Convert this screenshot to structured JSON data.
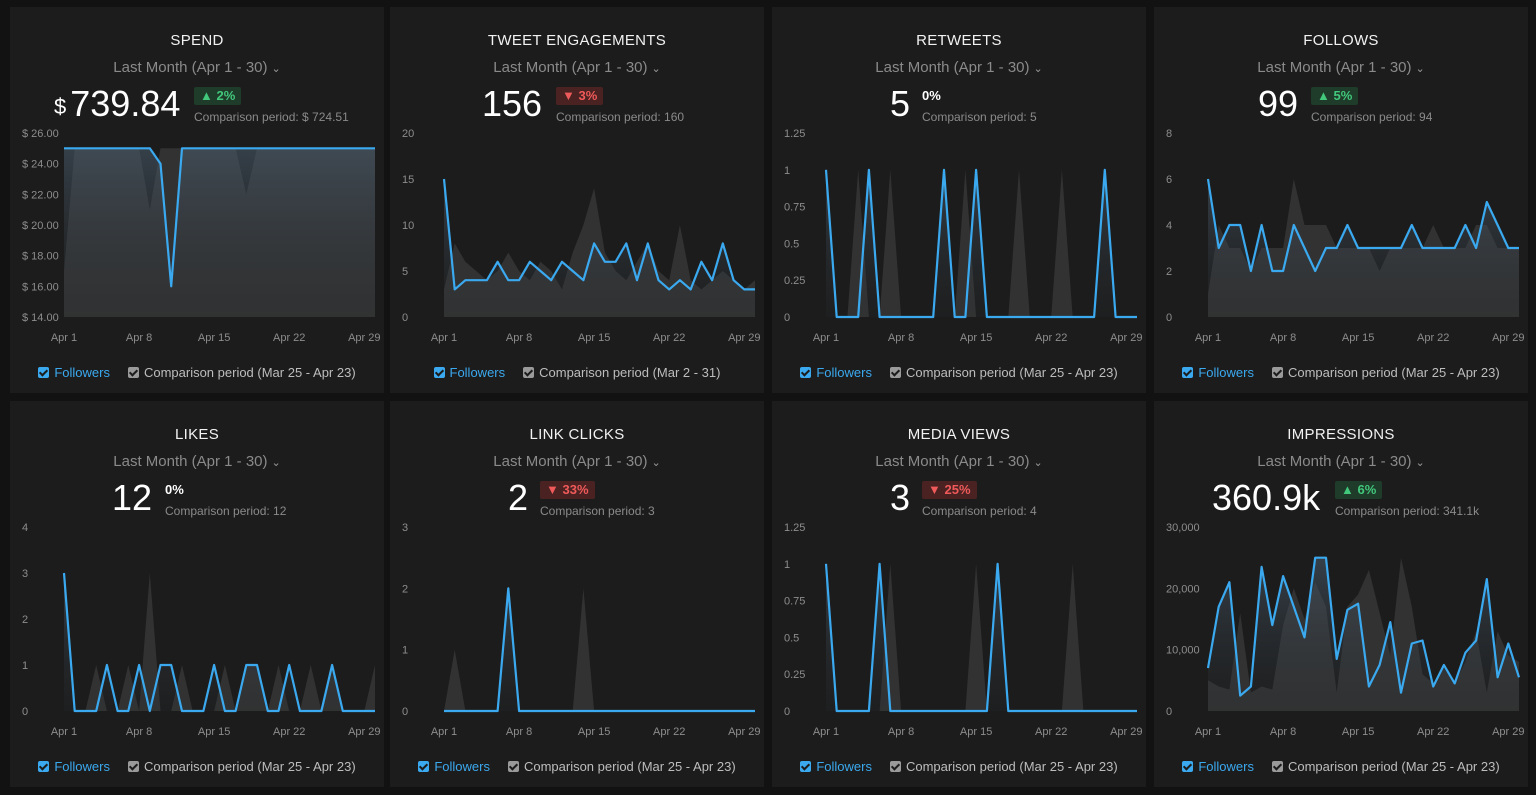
{
  "widgets": [
    {
      "title": "SPEND",
      "period": "Last Month (Apr 1 - 30)",
      "currency": "$",
      "value": "739.84",
      "change": {
        "direction": "up",
        "label": "▲ 2%"
      },
      "comparison_label": "Comparison period: $ 724.51",
      "legend": {
        "current": "Followers",
        "comparison": "Comparison period (Mar 25 - Apr 23)"
      },
      "colors": {
        "current": "#3ba9ef",
        "comparison": "#5a5a5a"
      },
      "chart_data": {
        "type": "area",
        "ylim": [
          14,
          26
        ],
        "yticks": [
          14,
          16,
          18,
          20,
          22,
          24,
          26
        ],
        "ytick_labels": [
          "$ 14.00",
          "$ 16.00",
          "$ 18.00",
          "$ 20.00",
          "$ 22.00",
          "$ 24.00",
          "$ 26.00"
        ],
        "xtick_labels": [
          "Apr 1",
          "Apr 8",
          "Apr 15",
          "Apr 22",
          "Apr 29"
        ],
        "xtick_index": [
          0,
          7,
          14,
          21,
          28
        ],
        "series": [
          {
            "name": "Followers",
            "values": [
              25,
              25,
              25,
              25,
              25,
              25,
              25,
              25,
              25,
              24,
              16,
              25,
              25,
              25,
              25,
              25,
              25,
              25,
              25,
              25,
              25,
              25,
              25,
              25,
              25,
              25,
              25,
              25,
              25,
              25
            ]
          },
          {
            "name": "Comparison period (Mar 25 - Apr 23)",
            "values": [
              17,
              25,
              25,
              25,
              25,
              25,
              25,
              25,
              21,
              25,
              25,
              25,
              25,
              25,
              25,
              25,
              25,
              22,
              25,
              25,
              25,
              25,
              25,
              25,
              25,
              25,
              25,
              25,
              25,
              25
            ]
          }
        ]
      }
    },
    {
      "title": "TWEET ENGAGEMENTS",
      "period": "Last Month (Apr 1 - 30)",
      "value": "156",
      "change": {
        "direction": "down",
        "label": "▼ 3%"
      },
      "comparison_label": "Comparison period: 160",
      "legend": {
        "current": "Followers",
        "comparison": "Comparison period (Mar 2 - 31)"
      },
      "colors": {
        "current": "#3ba9ef",
        "comparison": "#5a5a5a"
      },
      "chart_data": {
        "type": "area",
        "ylim": [
          0,
          20
        ],
        "yticks": [
          0,
          5,
          10,
          15,
          20
        ],
        "ytick_labels": [
          "0",
          "5",
          "10",
          "15",
          "20"
        ],
        "xtick_labels": [
          "Apr 1",
          "Apr 8",
          "Apr 15",
          "Apr 22",
          "Apr 29"
        ],
        "xtick_index": [
          0,
          7,
          14,
          21,
          28
        ],
        "series": [
          {
            "name": "Followers",
            "values": [
              15,
              3,
              4,
              4,
              4,
              6,
              4,
              4,
              6,
              5,
              4,
              6,
              5,
              4,
              8,
              6,
              6,
              8,
              4,
              8,
              4,
              3,
              4,
              3,
              6,
              4,
              8,
              4,
              3,
              3
            ]
          },
          {
            "name": "Comparison period (Mar 2 - 31)",
            "values": [
              3,
              8,
              6,
              5,
              4,
              5,
              7,
              5,
              4,
              6,
              5,
              3,
              7,
              10,
              14,
              7,
              5,
              4,
              6,
              8,
              5,
              4,
              10,
              4,
              3,
              4,
              5,
              4,
              3,
              4
            ]
          }
        ]
      }
    },
    {
      "title": "RETWEETS",
      "period": "Last Month (Apr 1 - 30)",
      "value": "5",
      "change": {
        "direction": "flat",
        "label": "0%"
      },
      "comparison_label": "Comparison period: 5",
      "legend": {
        "current": "Followers",
        "comparison": "Comparison period (Mar 25 - Apr 23)"
      },
      "colors": {
        "current": "#3ba9ef",
        "comparison": "#5a5a5a"
      },
      "chart_data": {
        "type": "area",
        "ylim": [
          0,
          1.25
        ],
        "yticks": [
          0,
          0.25,
          0.5,
          0.75,
          1,
          1.25
        ],
        "ytick_labels": [
          "0",
          "0.25",
          "0.5",
          "0.75",
          "1",
          "1.25"
        ],
        "xtick_labels": [
          "Apr 1",
          "Apr 8",
          "Apr 15",
          "Apr 22",
          "Apr 29"
        ],
        "xtick_index": [
          0,
          7,
          14,
          21,
          28
        ],
        "series": [
          {
            "name": "Followers",
            "values": [
              1,
              0,
              0,
              0,
              1,
              0,
              0,
              0,
              0,
              0,
              0,
              1,
              0,
              0,
              1,
              0,
              0,
              0,
              0,
              0,
              0,
              0,
              0,
              0,
              0,
              0,
              1,
              0,
              0,
              0
            ]
          },
          {
            "name": "Comparison period (Mar 25 - Apr 23)",
            "values": [
              0,
              0,
              0,
              1,
              0,
              0,
              1,
              0,
              0,
              0,
              0,
              0,
              0,
              1,
              0,
              0,
              0,
              0,
              1,
              0,
              0,
              0,
              1,
              0,
              0,
              0,
              0,
              0,
              0,
              0
            ]
          }
        ]
      }
    },
    {
      "title": "FOLLOWS",
      "period": "Last Month (Apr 1 - 30)",
      "value": "99",
      "change": {
        "direction": "up",
        "label": "▲ 5%"
      },
      "comparison_label": "Comparison period: 94",
      "legend": {
        "current": "Followers",
        "comparison": "Comparison period (Mar 25 - Apr 23)"
      },
      "colors": {
        "current": "#3ba9ef",
        "comparison": "#5a5a5a"
      },
      "chart_data": {
        "type": "area",
        "ylim": [
          0,
          8
        ],
        "yticks": [
          0,
          2,
          4,
          6,
          8
        ],
        "ytick_labels": [
          "0",
          "2",
          "4",
          "6",
          "8"
        ],
        "xtick_labels": [
          "Apr 1",
          "Apr 8",
          "Apr 15",
          "Apr 22",
          "Apr 29"
        ],
        "xtick_index": [
          0,
          7,
          14,
          21,
          28
        ],
        "series": [
          {
            "name": "Followers",
            "values": [
              6,
              3,
              4,
              4,
              2,
              4,
              2,
              2,
              4,
              3,
              2,
              3,
              3,
              4,
              3,
              3,
              3,
              3,
              3,
              4,
              3,
              3,
              3,
              3,
              4,
              3,
              5,
              4,
              3,
              3
            ]
          },
          {
            "name": "Comparison period (Mar 25 - Apr 23)",
            "values": [
              1,
              4,
              3,
              3,
              2,
              3,
              3,
              3,
              6,
              4,
              4,
              4,
              3,
              3,
              3,
              3,
              2,
              3,
              3,
              3,
              3,
              4,
              3,
              3,
              3,
              4,
              4,
              3,
              3,
              3
            ]
          }
        ]
      }
    },
    {
      "title": "LIKES",
      "period": "Last Month (Apr 1 - 30)",
      "value": "12",
      "change": {
        "direction": "flat",
        "label": "0%"
      },
      "comparison_label": "Comparison period: 12",
      "legend": {
        "current": "Followers",
        "comparison": "Comparison period (Mar 25 - Apr 23)"
      },
      "colors": {
        "current": "#3ba9ef",
        "comparison": "#5a5a5a"
      },
      "chart_data": {
        "type": "area",
        "ylim": [
          0,
          4
        ],
        "yticks": [
          0,
          1,
          2,
          3,
          4
        ],
        "ytick_labels": [
          "0",
          "1",
          "2",
          "3",
          "4"
        ],
        "xtick_labels": [
          "Apr 1",
          "Apr 8",
          "Apr 15",
          "Apr 22",
          "Apr 29"
        ],
        "xtick_index": [
          0,
          7,
          14,
          21,
          28
        ],
        "series": [
          {
            "name": "Followers",
            "values": [
              3,
              0,
              0,
              0,
              1,
              0,
              0,
              1,
              0,
              1,
              1,
              0,
              0,
              0,
              1,
              0,
              0,
              1,
              1,
              0,
              0,
              1,
              0,
              0,
              0,
              1,
              0,
              0,
              0,
              0
            ]
          },
          {
            "name": "Comparison period (Mar 25 - Apr 23)",
            "values": [
              0,
              0,
              0,
              1,
              0,
              0,
              1,
              0,
              3,
              0,
              0,
              1,
              0,
              0,
              0,
              1,
              0,
              1,
              1,
              0,
              1,
              0,
              0,
              1,
              0,
              1,
              0,
              0,
              0,
              1
            ]
          }
        ]
      }
    },
    {
      "title": "LINK CLICKS",
      "period": "Last Month (Apr 1 - 30)",
      "value": "2",
      "change": {
        "direction": "down",
        "label": "▼ 33%"
      },
      "comparison_label": "Comparison period: 3",
      "legend": {
        "current": "Followers",
        "comparison": "Comparison period (Mar 25 - Apr 23)"
      },
      "colors": {
        "current": "#3ba9ef",
        "comparison": "#5a5a5a"
      },
      "chart_data": {
        "type": "area",
        "ylim": [
          0,
          3
        ],
        "yticks": [
          0,
          1,
          2,
          3
        ],
        "ytick_labels": [
          "0",
          "1",
          "2",
          "3"
        ],
        "xtick_labels": [
          "Apr 1",
          "Apr 8",
          "Apr 15",
          "Apr 22",
          "Apr 29"
        ],
        "xtick_index": [
          0,
          7,
          14,
          21,
          28
        ],
        "series": [
          {
            "name": "Followers",
            "values": [
              0,
              0,
              0,
              0,
              0,
              0,
              2,
              0,
              0,
              0,
              0,
              0,
              0,
              0,
              0,
              0,
              0,
              0,
              0,
              0,
              0,
              0,
              0,
              0,
              0,
              0,
              0,
              0,
              0,
              0
            ]
          },
          {
            "name": "Comparison period (Mar 25 - Apr 23)",
            "values": [
              0,
              1,
              0,
              0,
              0,
              0,
              0,
              0,
              0,
              0,
              0,
              0,
              0,
              2,
              0,
              0,
              0,
              0,
              0,
              0,
              0,
              0,
              0,
              0,
              0,
              0,
              0,
              0,
              0,
              0
            ]
          }
        ]
      }
    },
    {
      "title": "MEDIA VIEWS",
      "period": "Last Month (Apr 1 - 30)",
      "value": "3",
      "change": {
        "direction": "down",
        "label": "▼ 25%"
      },
      "comparison_label": "Comparison period: 4",
      "legend": {
        "current": "Followers",
        "comparison": "Comparison period (Mar 25 - Apr 23)"
      },
      "colors": {
        "current": "#3ba9ef",
        "comparison": "#5a5a5a"
      },
      "chart_data": {
        "type": "area",
        "ylim": [
          0,
          1.25
        ],
        "yticks": [
          0,
          0.25,
          0.5,
          0.75,
          1,
          1.25
        ],
        "ytick_labels": [
          "0",
          "0.25",
          "0.5",
          "0.75",
          "1",
          "1.25"
        ],
        "xtick_labels": [
          "Apr 1",
          "Apr 8",
          "Apr 15",
          "Apr 22",
          "Apr 29"
        ],
        "xtick_index": [
          0,
          7,
          14,
          21,
          28
        ],
        "series": [
          {
            "name": "Followers",
            "values": [
              1,
              0,
              0,
              0,
              0,
              1,
              0,
              0,
              0,
              0,
              0,
              0,
              0,
              0,
              0,
              0,
              1,
              0,
              0,
              0,
              0,
              0,
              0,
              0,
              0,
              0,
              0,
              0,
              0,
              0
            ]
          },
          {
            "name": "Comparison period (Mar 25 - Apr 23)",
            "values": [
              0,
              0,
              0,
              0,
              0,
              0,
              1,
              0,
              0,
              0,
              0,
              0,
              0,
              0,
              1,
              0,
              0,
              0,
              0,
              0,
              0,
              0,
              0,
              1,
              0,
              0,
              0,
              0,
              0,
              0
            ]
          }
        ]
      }
    },
    {
      "title": "IMPRESSIONS",
      "period": "Last Month (Apr 1 - 30)",
      "value": "360.9k",
      "change": {
        "direction": "up",
        "label": "▲ 6%"
      },
      "comparison_label": "Comparison period: 341.1k",
      "legend": {
        "current": "Followers",
        "comparison": "Comparison period (Mar 25 - Apr 23)"
      },
      "colors": {
        "current": "#3ba9ef",
        "comparison": "#5a5a5a"
      },
      "chart_data": {
        "type": "area",
        "ylim": [
          0,
          30000
        ],
        "yticks": [
          0,
          10000,
          20000,
          30000
        ],
        "ytick_labels": [
          "0",
          "10,000",
          "20,000",
          "30,000"
        ],
        "xtick_labels": [
          "Apr 1",
          "Apr 8",
          "Apr 15",
          "Apr 22",
          "Apr 29"
        ],
        "xtick_index": [
          0,
          7,
          14,
          21,
          28
        ],
        "series": [
          {
            "name": "Followers",
            "values": [
              7000,
              17000,
              21000,
              2500,
              4000,
              23500,
              14000,
              22000,
              17000,
              12000,
              25000,
              25000,
              8500,
              16500,
              17500,
              4000,
              7500,
              14500,
              3000,
              11000,
              11500,
              4000,
              7500,
              4500,
              9500,
              11500,
              21500,
              5500,
              11000,
              5500
            ]
          },
          {
            "name": "Comparison period (Mar 25 - Apr 23)",
            "values": [
              5000,
              4000,
              3500,
              16000,
              3000,
              4000,
              3500,
              14000,
              20000,
              15000,
              21000,
              17000,
              3000,
              17000,
              19000,
              23000,
              16000,
              9000,
              25000,
              17000,
              6000,
              4500,
              7000,
              4500,
              8000,
              13000,
              3000,
              13000,
              9000,
              8000
            ]
          }
        ]
      }
    }
  ]
}
